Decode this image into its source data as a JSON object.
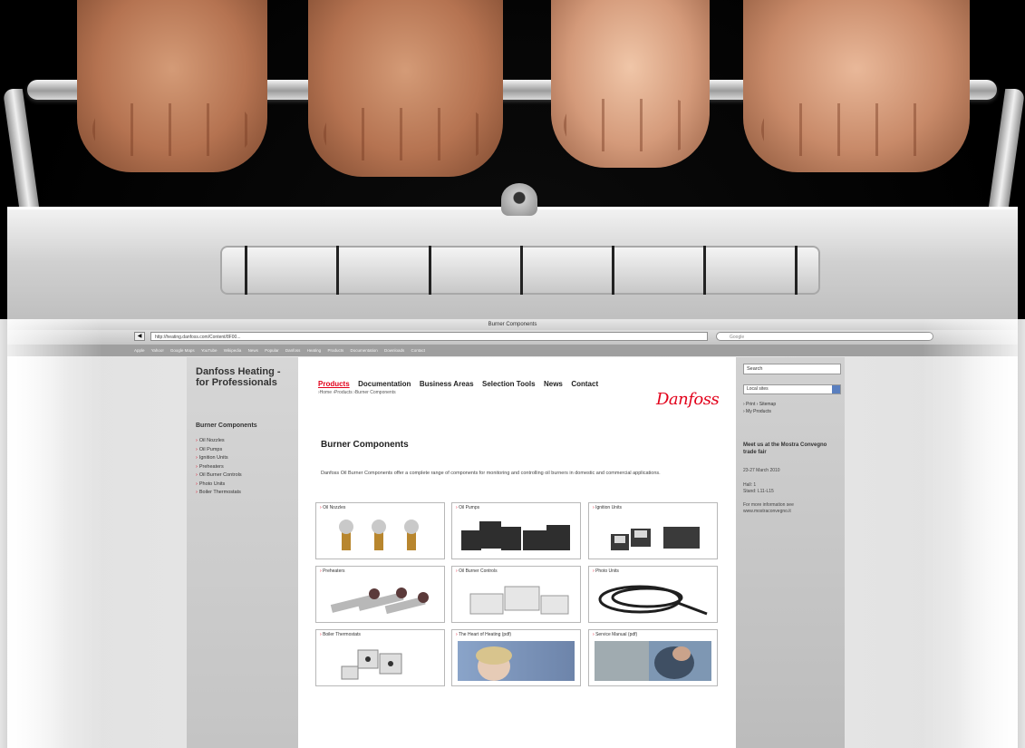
{
  "browser": {
    "window_title": "Burner Components",
    "url": "http://heating.danfoss.com/Content/8F00...",
    "search_placeholder": "Google",
    "back_glyph": "◀",
    "bookmarks": [
      "Apple",
      "Yahoo!",
      "Google Maps",
      "YouTube",
      "Wikipedia",
      "News",
      "Popular",
      "Danfoss",
      "Heating",
      "Products",
      "Documentation",
      "Downloads",
      "Contact"
    ]
  },
  "site": {
    "name": "Danfoss Heating - for Professionals",
    "logo": "Danfoss",
    "nav": [
      "Products",
      "Documentation",
      "Business Areas",
      "Selection Tools",
      "News",
      "Contact"
    ],
    "breadcrumb": "›Home ›Products ›Burner Components"
  },
  "sidebar": {
    "title": "Burner Components",
    "items": [
      "Oil Nozzles",
      "Oil Pumps",
      "Ignition Units",
      "Preheaters",
      "Oil Burner Controls",
      "Photo Units",
      "Boiler Thermostats"
    ]
  },
  "main": {
    "heading": "Burner Components",
    "intro": "Danfoss Oil Burner Components offer a complete range of components for monitoring and controlling oil burners in domestic and commercial applications.",
    "tiles": [
      "Oil Nozzles",
      "Oil Pumps",
      "Ignition Units",
      "Preheaters",
      "Oil Burner Controls",
      "Photo Units",
      "Boiler Thermostats",
      "The Heart of Heating (pdf)",
      "Service Manual (pdf)"
    ]
  },
  "right": {
    "search_label": "Search",
    "select_label": "Local sites",
    "links": "› Print › Sitemap\n› My Products",
    "event_head": "Meet us at the Mostra Convegno trade fair",
    "event_date": "23-27 March 2010",
    "event_hall": "Hall: 1\nStand: L11-L15",
    "event_more": "For more information see www.mostraconvegno.it"
  }
}
